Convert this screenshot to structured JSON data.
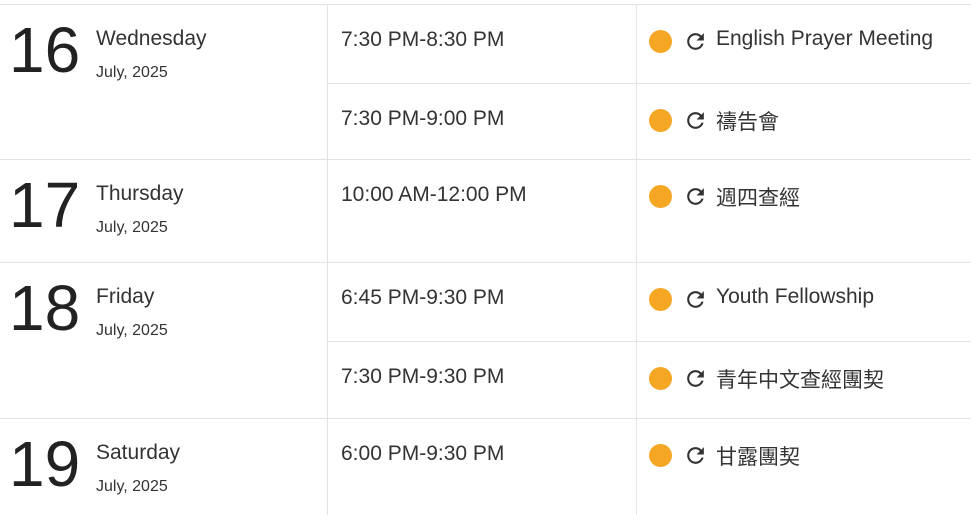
{
  "colors": {
    "event_dot": "#F5A623",
    "divider": "#e3e3e3"
  },
  "icons": {
    "recurring": "refresh-icon"
  },
  "days": [
    {
      "number": "16",
      "weekday": "Wednesday",
      "month_year": "July, 2025",
      "events": [
        {
          "time": "7:30 PM-8:30 PM",
          "title": "English Prayer Meeting"
        },
        {
          "time": "7:30 PM-9:00 PM",
          "title": "禱告會"
        }
      ]
    },
    {
      "number": "17",
      "weekday": "Thursday",
      "month_year": "July, 2025",
      "events": [
        {
          "time": "10:00 AM-12:00 PM",
          "title": "週四查經"
        }
      ]
    },
    {
      "number": "18",
      "weekday": "Friday",
      "month_year": "July, 2025",
      "events": [
        {
          "time": "6:45 PM-9:30 PM",
          "title": "Youth Fellowship"
        },
        {
          "time": "7:30 PM-9:30 PM",
          "title": "青年中文查經團契"
        }
      ]
    },
    {
      "number": "19",
      "weekday": "Saturday",
      "month_year": "July, 2025",
      "events": [
        {
          "time": "6:00 PM-9:30 PM",
          "title": "甘露團契"
        }
      ]
    }
  ]
}
